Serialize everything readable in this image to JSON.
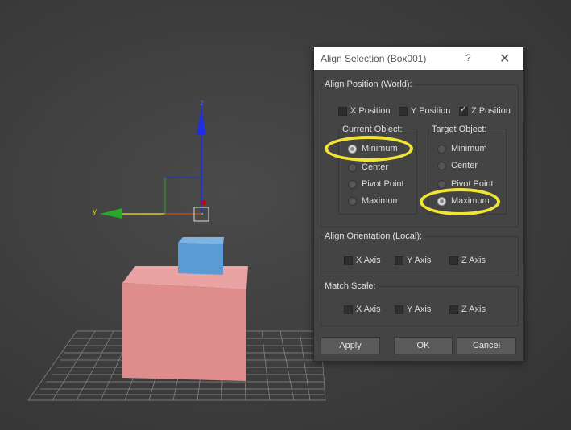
{
  "viewport": {
    "axis_z": "z",
    "axis_y": "y"
  },
  "dialog": {
    "title": "Align Selection (Box001)",
    "help_glyph": "?",
    "close_glyph": "✕",
    "align_position": {
      "label": "Align Position (World):",
      "x_position": "X Position",
      "y_position": "Y Position",
      "z_position": "Z Position",
      "checked": {
        "x": false,
        "y": false,
        "z": true
      }
    },
    "current_object": {
      "label": "Current Object:",
      "options": [
        "Minimum",
        "Center",
        "Pivot Point",
        "Maximum"
      ],
      "selected": "Minimum"
    },
    "target_object": {
      "label": "Target Object:",
      "options": [
        "Minimum",
        "Center",
        "Pivot Point",
        "Maximum"
      ],
      "selected": "Maximum"
    },
    "align_orientation": {
      "label": "Align Orientation (Local):",
      "x_axis": "X Axis",
      "y_axis": "Y Axis",
      "z_axis": "Z Axis"
    },
    "match_scale": {
      "label": "Match Scale:",
      "x_axis": "X Axis",
      "y_axis": "Y Axis",
      "z_axis": "Z Axis"
    },
    "buttons": {
      "apply": "Apply",
      "ok": "OK",
      "cancel": "Cancel"
    }
  },
  "colors": {
    "highlight": "#f0e534",
    "box_pink": "#de8c8c",
    "box_blue": "#5b9bd5"
  }
}
